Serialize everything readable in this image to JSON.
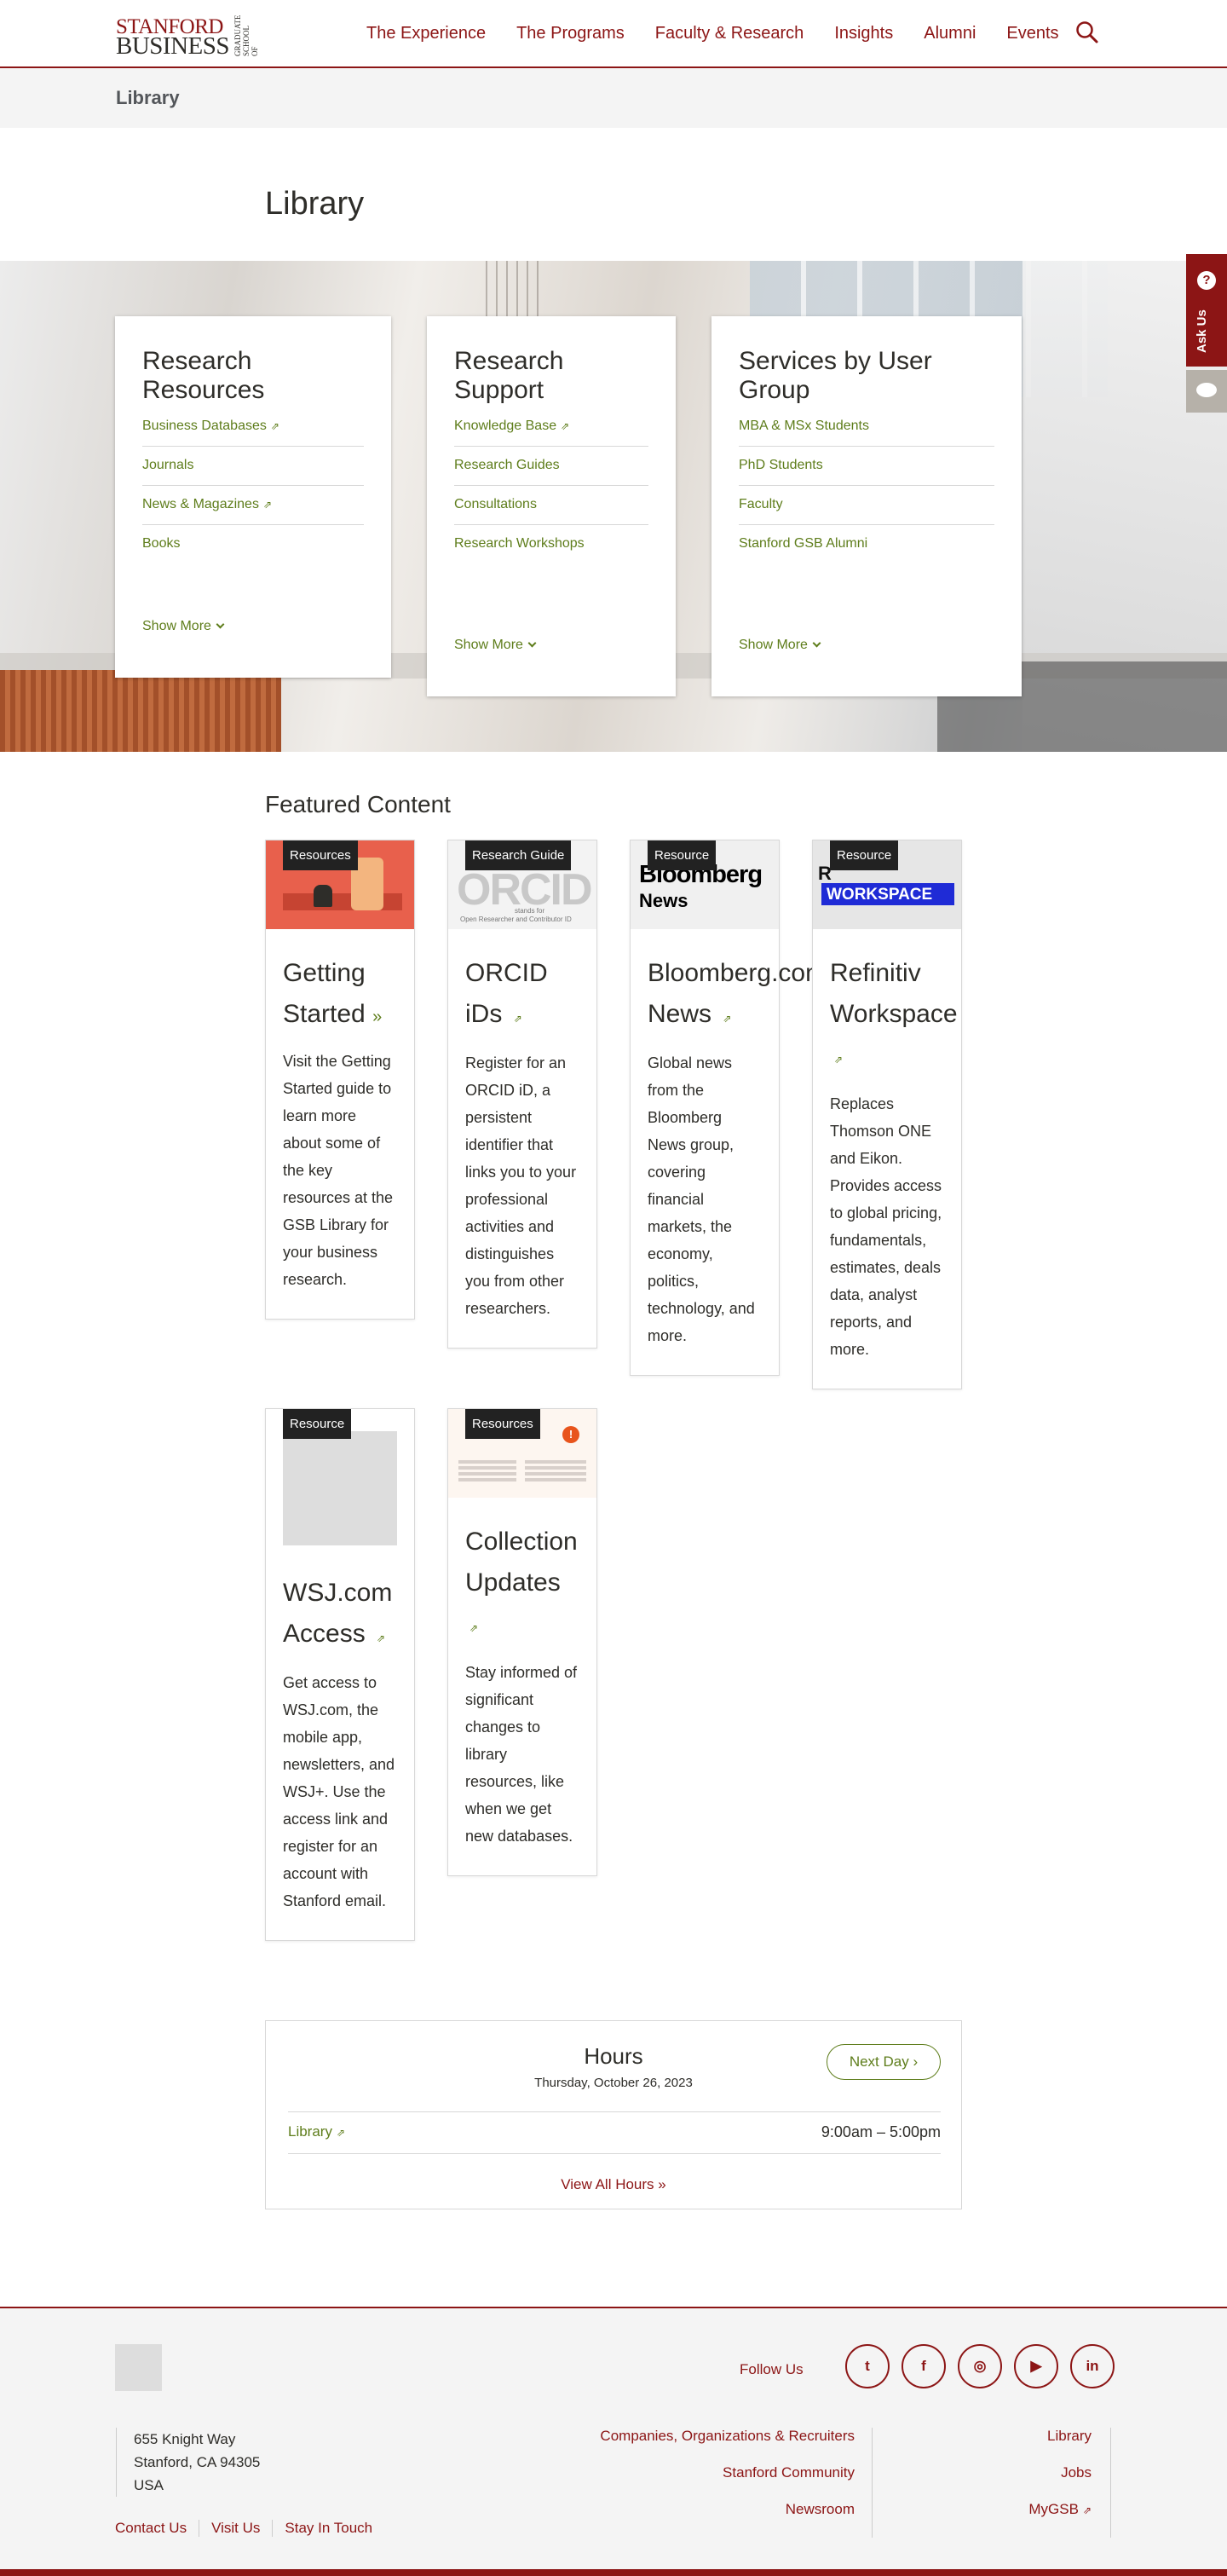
{
  "header": {
    "logo_line1": "STANFORD",
    "logo_line2": "BUSINESS",
    "logo_side": "GRADUATE SCHOOL OF",
    "nav": [
      "The Experience",
      "The Programs",
      "Faculty & Research",
      "Insights",
      "Alumni",
      "Events"
    ],
    "search_icon": "search-icon"
  },
  "section_bar": {
    "label": "Library"
  },
  "page": {
    "title": "Library"
  },
  "hero_cards": [
    {
      "title": "Research Resources",
      "links": [
        "Business Databases",
        "Journals",
        "News & Magazines",
        "Books"
      ],
      "show_more": "Show More"
    },
    {
      "title": "Research Support",
      "links": [
        "Knowledge Base",
        "Research Guides",
        "Consultations",
        "Research Workshops"
      ],
      "show_more": "Show More"
    },
    {
      "title": "Services by User Group",
      "links": [
        "MBA & MSx Students",
        "PhD Students",
        "Faculty",
        "Stanford GSB Alumni"
      ],
      "show_more": "Show More"
    }
  ],
  "ask_us": {
    "label": "Ask Us",
    "icon": "?"
  },
  "featured": {
    "heading": "Featured Content",
    "cards": [
      {
        "tag": "Resources",
        "title_l1": "Getting",
        "title_l2": "Started",
        "desc": "Visit the Getting Started guide to learn more about some of the key resources at the GSB Library for your business research."
      },
      {
        "tag": "Research Guide",
        "title_l1": "ORCID",
        "title_l2": "iDs",
        "desc": "Register for an ORCID iD, a persistent identifier that links you to your professional activities and distinguishes you from other researchers.",
        "thumb_text": "ORCID",
        "thumb_sub": "stands for",
        "thumb_sub2": "Open Researcher and Contributor ID"
      },
      {
        "tag": "Resource",
        "title_l1": "Bloomberg.com",
        "title_l2": "News",
        "desc": "Global news from the Bloomberg News group, covering financial markets, the economy, politics, technology, and more.",
        "thumb_text": "Bloomberg",
        "thumb_sub": "News"
      },
      {
        "tag": "Resource",
        "title_l1": "Refinitiv",
        "title_l2": "Workspace",
        "desc": "Replaces Thomson ONE and Eikon. Provides access to global pricing, fundamentals, estimates, deals data, analyst reports, and more.",
        "thumb_text": "WORKSPACE",
        "thumb_pre": "R"
      },
      {
        "tag": "Resource",
        "title_l1": "WSJ.com",
        "title_l2": "Access",
        "desc": "Get access to WSJ.com, the mobile app, newsletters, and WSJ+. Use the access link and register for an account with Stanford email."
      },
      {
        "tag": "Resources",
        "title_l1": "Collection",
        "title_l2": "Updates",
        "desc": "Stay informed of significant changes to library resources, like when we get new databases."
      }
    ]
  },
  "hours": {
    "title": "Hours",
    "date": "Thursday, October 26, 2023",
    "next_day": "Next Day",
    "location": "Library",
    "time": "9:00am – 5:00pm",
    "view_all": "View All Hours"
  },
  "footer": {
    "follow_us": "Follow Us",
    "socials": [
      "twitter-icon",
      "facebook-icon",
      "instagram-icon",
      "youtube-icon",
      "linkedin-icon"
    ],
    "address": [
      "655 Knight Way",
      "Stanford, CA 94305",
      "USA"
    ],
    "links_mid": [
      "Companies, Organizations & Recruiters",
      "Stanford Community",
      "Newsroom"
    ],
    "links_right": [
      "Library",
      "Jobs",
      "MyGSB"
    ],
    "utility": [
      "Contact Us",
      "Visit Us",
      "Stay In Touch"
    ]
  },
  "colors": {
    "cardinal": "#8c1515",
    "link_green": "#5e7d1b"
  }
}
